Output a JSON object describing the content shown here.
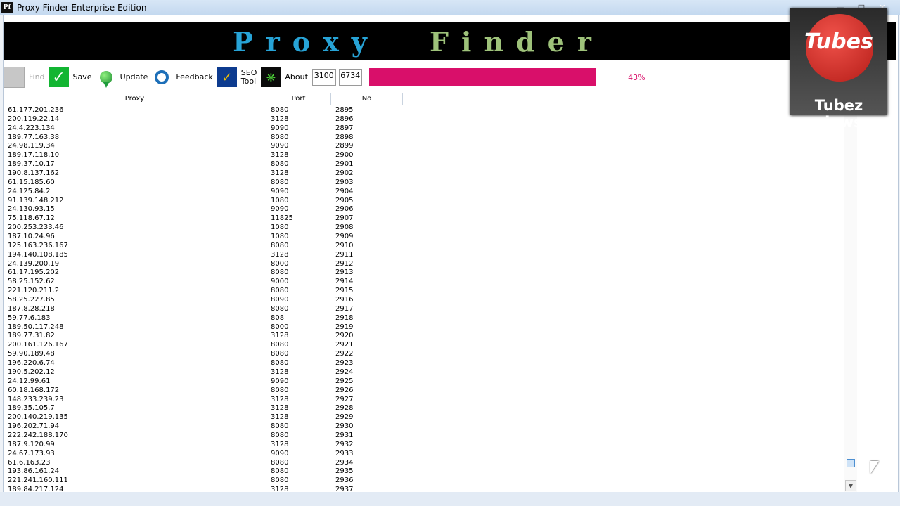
{
  "window": {
    "title": "Proxy Finder Enterprise Edition",
    "icon_label": "Pf"
  },
  "banner": {
    "word1": "Proxy",
    "word2": "Finder"
  },
  "toolbar": {
    "find_label": "Find",
    "save_label": "Save",
    "update_label": "Update",
    "feedback_label": "Feedback",
    "seo_label_1": "SEO",
    "seo_label_2": "Tool",
    "about_label": "About"
  },
  "counters": {
    "current": "3100",
    "total": "6734"
  },
  "progress": {
    "percent": 43,
    "label": "43%"
  },
  "table": {
    "headers": {
      "proxy": "Proxy",
      "port": "Port",
      "no": "No"
    },
    "rows": [
      [
        "61.177.201.236",
        "8080",
        "2895"
      ],
      [
        "200.119.22.14",
        "3128",
        "2896"
      ],
      [
        "24.4.223.134",
        "9090",
        "2897"
      ],
      [
        "189.77.163.38",
        "8080",
        "2898"
      ],
      [
        "24.98.119.34",
        "9090",
        "2899"
      ],
      [
        "189.17.118.10",
        "3128",
        "2900"
      ],
      [
        "189.37.10.17",
        "8080",
        "2901"
      ],
      [
        "190.8.137.162",
        "3128",
        "2902"
      ],
      [
        "61.15.185.60",
        "8080",
        "2903"
      ],
      [
        "24.125.84.2",
        "9090",
        "2904"
      ],
      [
        "91.139.148.212",
        "1080",
        "2905"
      ],
      [
        "24.130.93.15",
        "9090",
        "2906"
      ],
      [
        "75.118.67.12",
        "11825",
        "2907"
      ],
      [
        "200.253.233.46",
        "1080",
        "2908"
      ],
      [
        "187.10.24.96",
        "1080",
        "2909"
      ],
      [
        "125.163.236.167",
        "8080",
        "2910"
      ],
      [
        "194.140.108.185",
        "3128",
        "2911"
      ],
      [
        "24.139.200.19",
        "8000",
        "2912"
      ],
      [
        "61.17.195.202",
        "8080",
        "2913"
      ],
      [
        "58.25.152.62",
        "9000",
        "2914"
      ],
      [
        "221.120.211.2",
        "8080",
        "2915"
      ],
      [
        "58.25.227.85",
        "8090",
        "2916"
      ],
      [
        "187.8.28.218",
        "8080",
        "2917"
      ],
      [
        "59.77.6.183",
        "808",
        "2918"
      ],
      [
        "189.50.117.248",
        "8000",
        "2919"
      ],
      [
        "189.77.31.82",
        "3128",
        "2920"
      ],
      [
        "200.161.126.167",
        "8080",
        "2921"
      ],
      [
        "59.90.189.48",
        "8080",
        "2922"
      ],
      [
        "196.220.6.74",
        "8080",
        "2923"
      ],
      [
        "190.5.202.12",
        "3128",
        "2924"
      ],
      [
        "24.12.99.61",
        "9090",
        "2925"
      ],
      [
        "60.18.168.172",
        "8080",
        "2926"
      ],
      [
        "148.233.239.23",
        "3128",
        "2927"
      ],
      [
        "189.35.105.7",
        "3128",
        "2928"
      ],
      [
        "200.140.219.135",
        "3128",
        "2929"
      ],
      [
        "196.202.71.94",
        "8080",
        "2930"
      ],
      [
        "222.242.188.170",
        "8080",
        "2931"
      ],
      [
        "187.9.120.99",
        "3128",
        "2932"
      ],
      [
        "24.67.173.93",
        "9090",
        "2933"
      ],
      [
        "61.6.163.23",
        "8080",
        "2934"
      ],
      [
        "193.86.161.24",
        "8080",
        "2935"
      ],
      [
        "221.241.160.111",
        "8080",
        "2936"
      ],
      [
        "189.84.217.124",
        "3128",
        "2937"
      ]
    ]
  },
  "badge": {
    "top": "Tubes",
    "bottom": "Tubez views"
  },
  "colors": {
    "progress": "#d90f6a",
    "banner_bg": "#000000"
  }
}
